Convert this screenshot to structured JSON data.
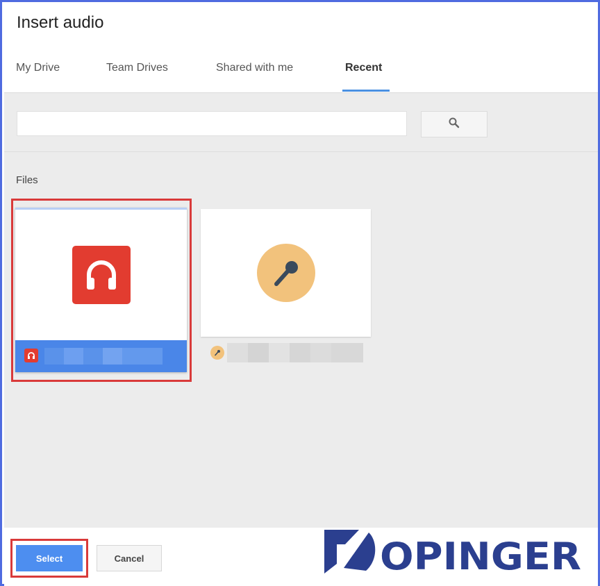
{
  "dialog": {
    "title": "Insert audio"
  },
  "tabs": [
    {
      "label": "My Drive",
      "active": false
    },
    {
      "label": "Team Drives",
      "active": false
    },
    {
      "label": "Shared with me",
      "active": false
    },
    {
      "label": "Recent",
      "active": true
    }
  ],
  "search": {
    "value": "",
    "placeholder": "",
    "button_icon": "search-icon"
  },
  "files": {
    "section_label": "Files",
    "items": [
      {
        "type": "audio",
        "icon": "headphones-icon",
        "selected": true,
        "name_redacted": true,
        "accent": "#e23c30"
      },
      {
        "type": "audio",
        "icon": "microphone-icon",
        "selected": false,
        "name_redacted": true,
        "accent": "#f2c27c"
      }
    ]
  },
  "footer": {
    "select_label": "Select",
    "cancel_label": "Cancel"
  },
  "watermark": {
    "brand": "DOPINGER",
    "color": "#2b3f8f"
  },
  "colors": {
    "frame": "#4f6be0",
    "accent": "#4a86e8",
    "highlight": "#d93a3a"
  }
}
